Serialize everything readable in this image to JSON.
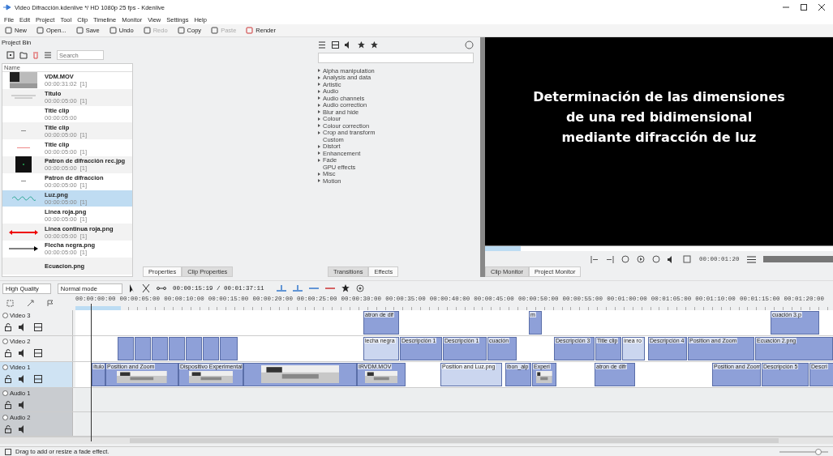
{
  "window": {
    "title": "Video Difracción.kdenlive */ HD 1080p 25 fps - Kdenlive"
  },
  "menu": [
    "File",
    "Edit",
    "Project",
    "Tool",
    "Clip",
    "Timeline",
    "Monitor",
    "View",
    "Settings",
    "Help"
  ],
  "toolbar": [
    {
      "label": "New",
      "disabled": false
    },
    {
      "label": "Open...",
      "disabled": false
    },
    {
      "label": "Save",
      "disabled": false
    },
    {
      "label": "Undo",
      "disabled": false
    },
    {
      "label": "Redo",
      "disabled": true
    },
    {
      "label": "Copy",
      "disabled": false
    },
    {
      "label": "Paste",
      "disabled": true
    },
    {
      "label": "Render",
      "disabled": false
    }
  ],
  "project_bin": {
    "title": "Project Bin",
    "search_placeholder": "Search",
    "column": "Name",
    "items": [
      {
        "name": "VDM.MOV",
        "duration": "00:00:31:02  [1]",
        "kind": "video",
        "selected": false
      },
      {
        "name": "Titulo",
        "duration": "00:00:05:00  [1]",
        "kind": "lines",
        "selected": false
      },
      {
        "name": "Title clip",
        "duration": "00:00:05:00",
        "kind": "blank",
        "selected": false
      },
      {
        "name": "Title clip",
        "duration": "00:00:05:00  [1]",
        "kind": "dash",
        "selected": false
      },
      {
        "name": "Title clip",
        "duration": "00:00:05:00  [1]",
        "kind": "redline",
        "selected": false
      },
      {
        "name": "Patron de difracción rec.jpg",
        "duration": "00:00:05:00  [1]",
        "kind": "dark",
        "selected": false
      },
      {
        "name": "Patron de difraccion",
        "duration": "00:00:05:00  [1]",
        "kind": "dash",
        "selected": false
      },
      {
        "name": "Luz.png",
        "duration": "00:00:05:00  [1]",
        "kind": "wave",
        "selected": true
      },
      {
        "name": "Linea roja.png",
        "duration": "00:00:05:00  [1]",
        "kind": "blank",
        "selected": false
      },
      {
        "name": "Linea continua roja.png",
        "duration": "00:00:05:00  [1]",
        "kind": "redarrow",
        "selected": false
      },
      {
        "name": "Flecha negra.png",
        "duration": "00:00:05:00  [1]",
        "kind": "arrow",
        "selected": false
      },
      {
        "name": "Ecuacion.png",
        "kind": "blank",
        "selected": false
      }
    ]
  },
  "properties_tabs": [
    {
      "label": "Properties",
      "selected": true
    },
    {
      "label": "Clip Properties",
      "selected": false
    }
  ],
  "effects": {
    "categories": [
      {
        "label": "Alpha manipulation",
        "expandable": true
      },
      {
        "label": "Analysis and data",
        "expandable": true
      },
      {
        "label": "Artistic",
        "expandable": true
      },
      {
        "label": "Audio",
        "expandable": true
      },
      {
        "label": "Audio channels",
        "expandable": true
      },
      {
        "label": "Audio correction",
        "expandable": true
      },
      {
        "label": "Blur and hide",
        "expandable": true
      },
      {
        "label": "Colour",
        "expandable": true
      },
      {
        "label": "Colour correction",
        "expandable": true
      },
      {
        "label": "Crop and transform",
        "expandable": true
      },
      {
        "label": "Custom",
        "expandable": false
      },
      {
        "label": "Distort",
        "expandable": true
      },
      {
        "label": "Enhancement",
        "expandable": true
      },
      {
        "label": "Fade",
        "expandable": true
      },
      {
        "label": "GPU effects",
        "expandable": false
      },
      {
        "label": "Misc",
        "expandable": true
      },
      {
        "label": "Motion",
        "expandable": true
      }
    ],
    "tabs": [
      {
        "label": "Transitions",
        "selected": false
      },
      {
        "label": "Effects",
        "selected": true
      }
    ]
  },
  "monitor": {
    "lines": [
      "Determinación de las dimensiones",
      "de una red bidimensional",
      "mediante difracción de luz"
    ],
    "timecode": "00:00:01:20",
    "tabs": [
      {
        "label": "Clip Monitor",
        "selected": false
      },
      {
        "label": "Project Monitor",
        "selected": true
      }
    ]
  },
  "timeline": {
    "quality": "High Quality",
    "mode": "Normal mode",
    "timecode": "00:00:15:19 / 00:01:37:11",
    "ruler": [
      "00:00:00:00",
      "00:00:05:00",
      "00:00:10:00",
      "00:00:15:00",
      "00:00:20:00",
      "00:00:25:00",
      "00:00:30:00",
      "00:00:35:00",
      "00:00:40:00",
      "00:00:45:00",
      "00:00:50:00",
      "00:00:55:00",
      "00:01:00:00",
      "00:01:05:00",
      "00:01:10:00",
      "00:01:15:00",
      "00:01:20:00"
    ],
    "tracks": [
      {
        "name": "Video 3",
        "kind": "video",
        "selected": false,
        "clips": [
          {
            "label": "atron de dif",
            "kind": "title"
          },
          {
            "label": "m",
            "kind": "title"
          },
          {
            "label": "cuación 3.p",
            "kind": "title"
          }
        ]
      },
      {
        "name": "Video 2",
        "kind": "video",
        "selected": false,
        "clips": [
          {
            "kind": "title"
          },
          {
            "kind": "title"
          },
          {
            "kind": "title"
          },
          {
            "kind": "title"
          },
          {
            "kind": "title"
          },
          {
            "kind": "title"
          },
          {
            "kind": "title"
          },
          {
            "label": "lecha negra"
          },
          {
            "label": "Descripción 1",
            "kind": "title"
          },
          {
            "label": "Descripción 1",
            "kind": "title"
          },
          {
            "label": "cuación",
            "kind": "title"
          },
          {
            "label": "Descripción 3",
            "kind": "title"
          },
          {
            "label": "Title clip",
            "kind": "title"
          },
          {
            "label": "ínea ro"
          },
          {
            "label": "Descripción 4",
            "kind": "title"
          },
          {
            "label": "Position and Zoom",
            "kind": "title"
          },
          {
            "label": "Ecuación 2.png",
            "kind": "title"
          }
        ]
      },
      {
        "name": "Video 1",
        "kind": "video",
        "selected": true,
        "clips": [
          {
            "label": "ítulo",
            "kind": "title"
          },
          {
            "label": "Position and Zoom",
            "kind": "video"
          },
          {
            "label": "Dispositivo Experimental",
            "kind": "video"
          },
          {
            "kind": "video"
          },
          {
            "label": "IRVDM.MOV",
            "kind": "video"
          },
          {
            "label": "Position and Luz.png"
          },
          {
            "label": "ibon_alp",
            "kind": "title"
          },
          {
            "label": "Experi",
            "kind": "video"
          },
          {
            "label": "atron de difr",
            "kind": "title"
          },
          {
            "label": "Position and Zoom",
            "kind": "title"
          },
          {
            "label": "Descripción 5",
            "kind": "title"
          },
          {
            "label": "Descri",
            "kind": "title"
          }
        ]
      },
      {
        "name": "Audio 1",
        "kind": "audio",
        "selected": false
      },
      {
        "name": "Audio 2",
        "kind": "audio",
        "selected": false
      }
    ]
  },
  "status_bar": {
    "message": "Drag to add or resize a fade effect.",
    "zoom": {
      "level": 0.8
    }
  }
}
